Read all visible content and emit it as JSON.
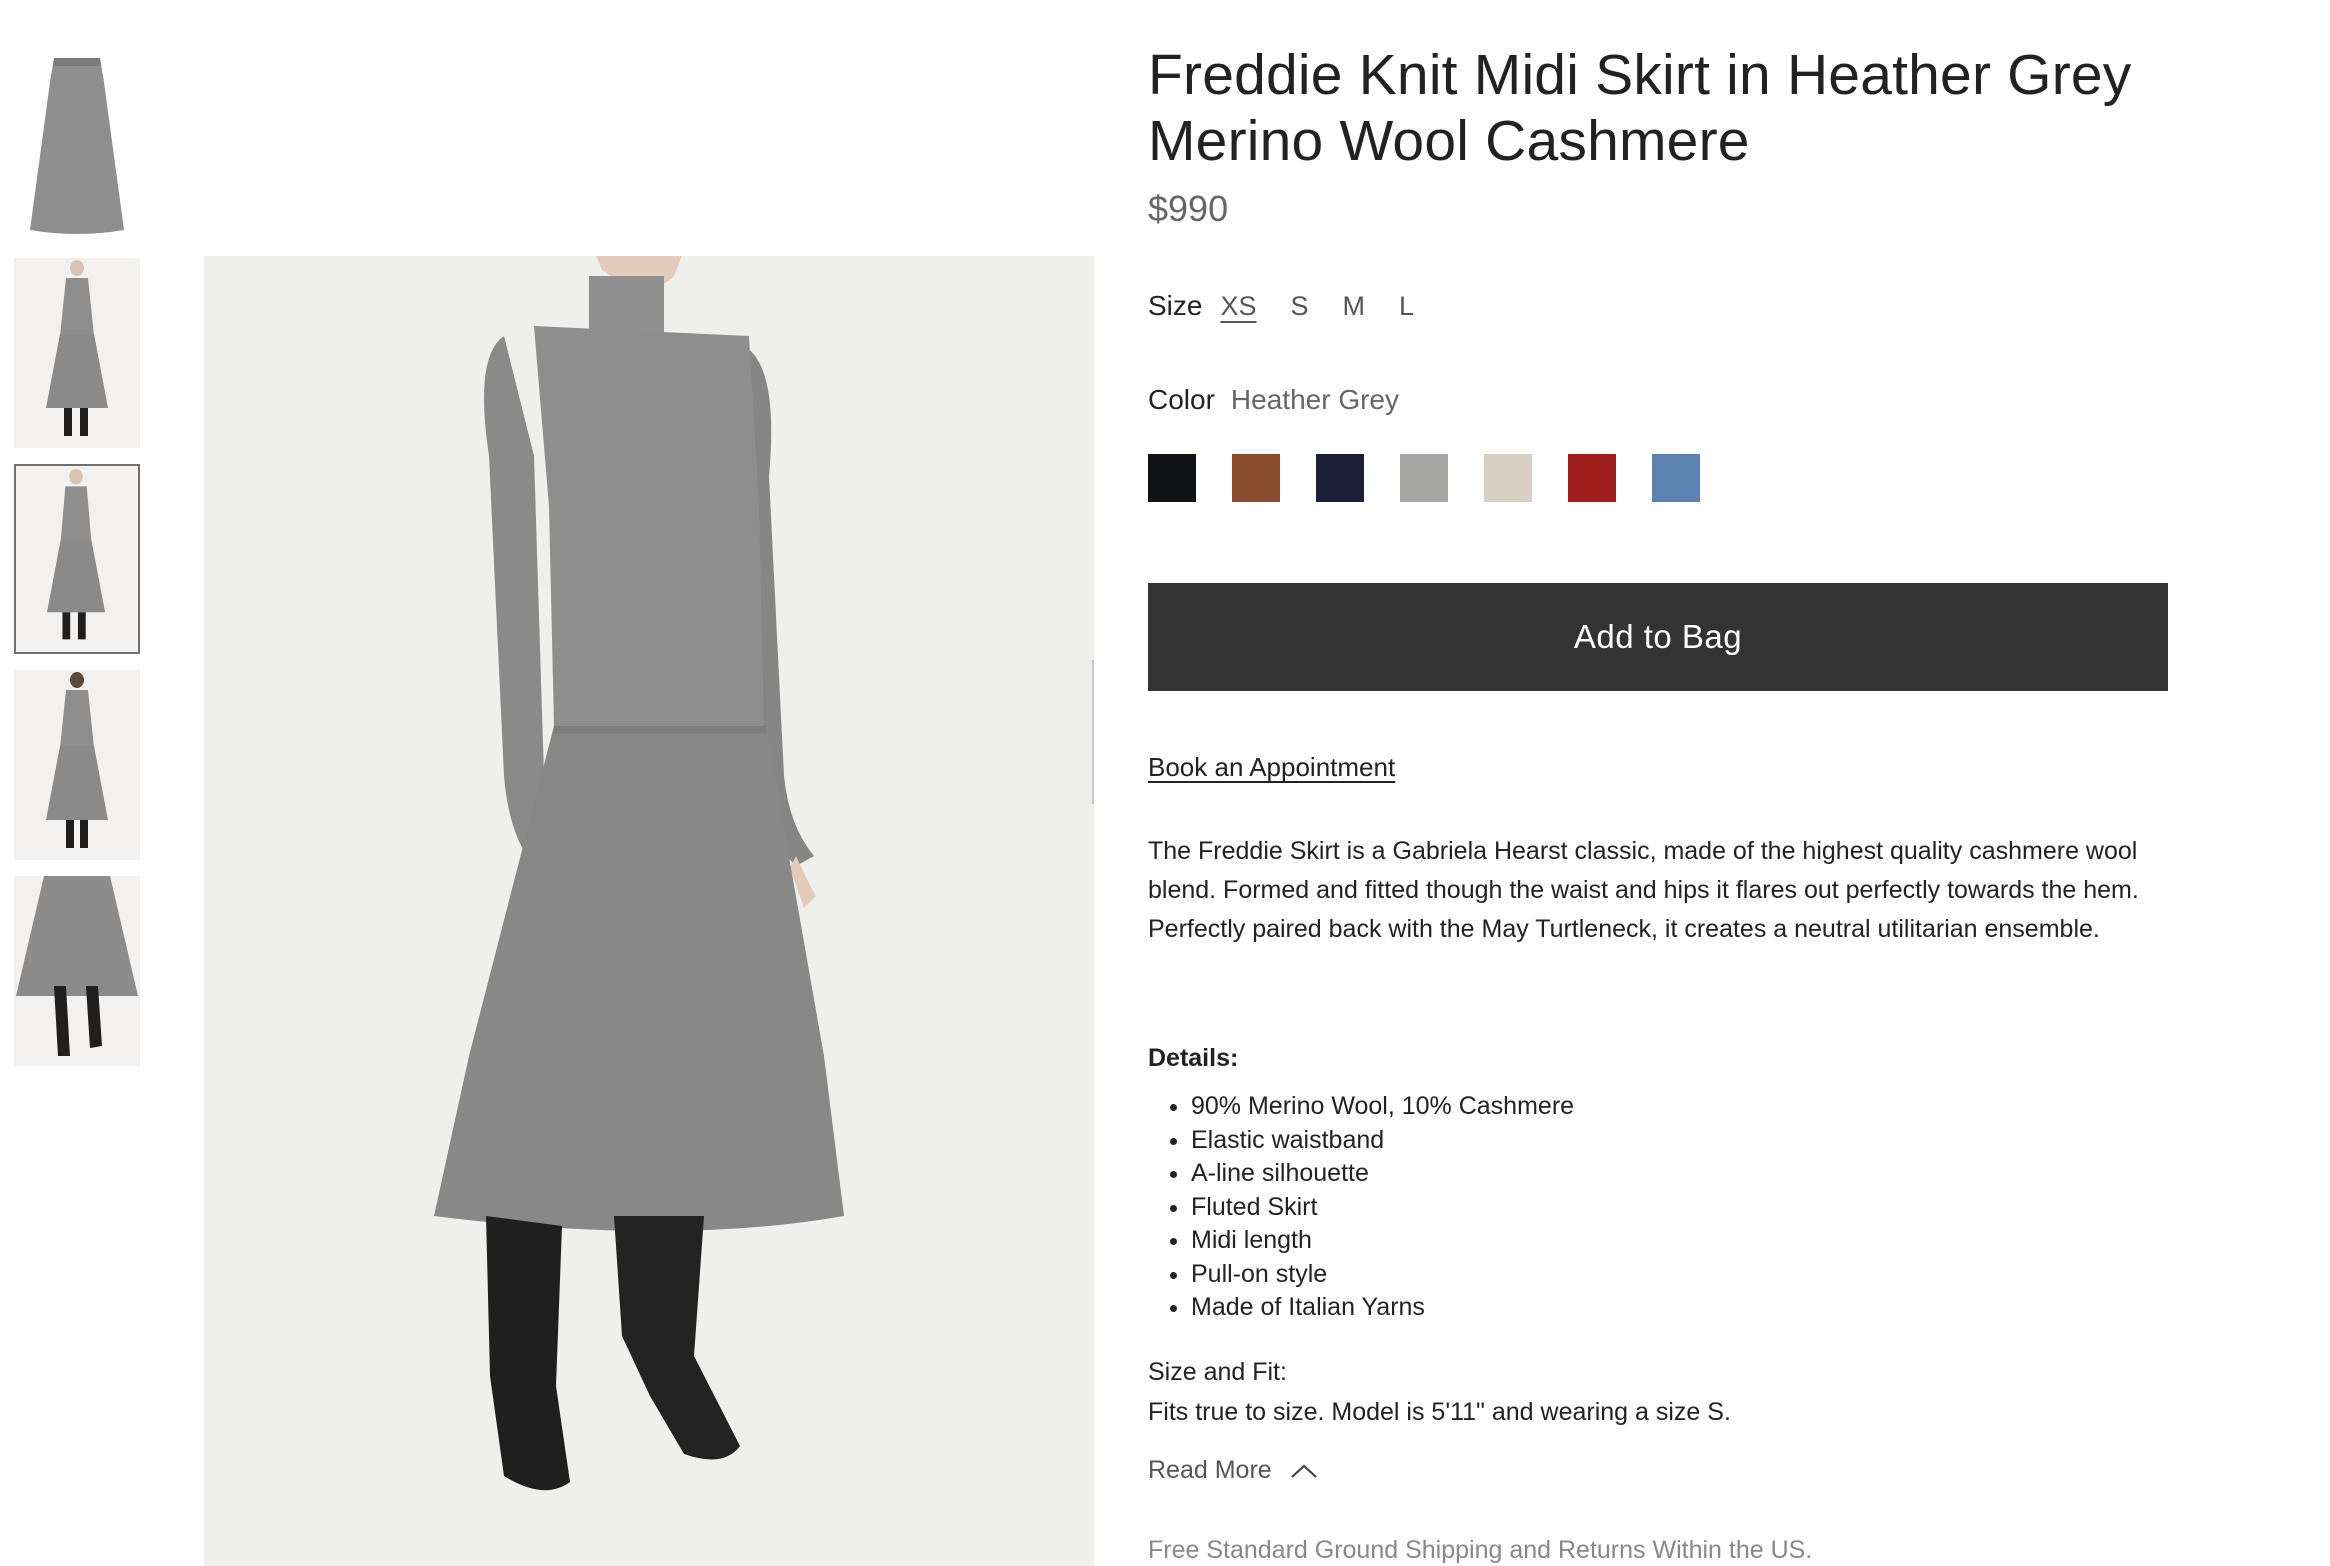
{
  "product": {
    "title": "Freddie Knit Midi Skirt in Heather Grey Merino Wool Cashmere",
    "price": "$990"
  },
  "size": {
    "label": "Size",
    "options": [
      "XS",
      "S",
      "M",
      "L"
    ],
    "selected": "XS"
  },
  "color": {
    "label": "Color",
    "value": "Heather Grey",
    "swatches": [
      "#121316",
      "#8a4a2c",
      "#1d1f38",
      "#a6a6a4",
      "#d9cfc4",
      "#9e1e1e",
      "#5b82b0"
    ]
  },
  "actions": {
    "add_to_bag": "Add to Bag",
    "book_appointment": "Book an Appointment",
    "read_more": "Read More"
  },
  "description": "The Freddie Skirt is a Gabriela Hearst classic, made of the highest quality cashmere wool blend. Formed and fitted though the waist and hips it flares out perfectly towards the hem. Perfectly paired back with the May Turtleneck, it creates a neutral utilitarian ensemble.",
  "details": {
    "heading": "Details:",
    "items": [
      "90% Merino Wool, 10% Cashmere",
      "Elastic waistband",
      "A-line silhouette",
      "Fluted Skirt",
      "Midi length",
      "Pull-on style",
      "Made of Italian Yarns"
    ]
  },
  "size_and_fit": {
    "heading": "Size and Fit:",
    "text": "Fits true to size. Model is 5'11\" and wearing a size S."
  },
  "shipping": "Free Standard Ground Shipping and Returns Within the US.",
  "gallery": {
    "thumbnail_count": 5,
    "selected_index": 2
  }
}
